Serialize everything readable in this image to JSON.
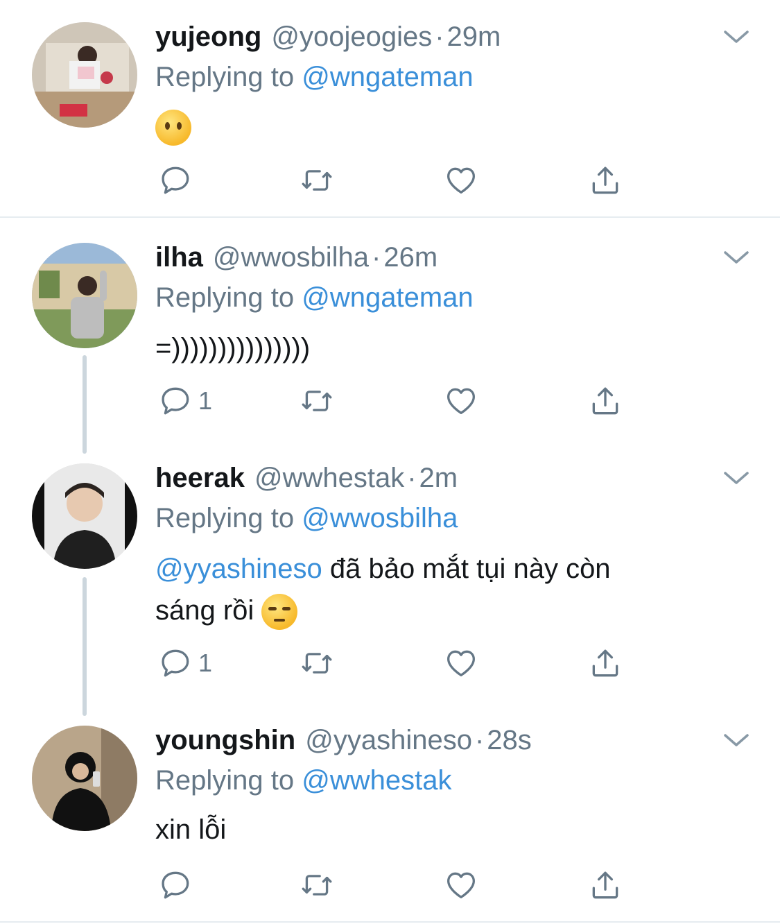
{
  "tweets": [
    {
      "name": "yujeong",
      "handle": "@yoojeogies",
      "time": "29m",
      "replying_prefix": "Replying to",
      "replying_to": "@wngateman",
      "body_emoji": "no-mouth-face",
      "reply_count": "",
      "avatar_colors": {
        "bg": "#cfc6b8",
        "accent": "#c5394a"
      }
    },
    {
      "name": "ilha",
      "handle": "@wwosbilha",
      "time": "26m",
      "replying_prefix": "Replying to",
      "replying_to": "@wngateman",
      "body": "=)))))))))))))))",
      "reply_count": "1",
      "avatar_colors": {
        "bg": "#9bb9d8",
        "accent": "#8e8e8e"
      }
    },
    {
      "name": "heerak",
      "handle": "@wwhestak",
      "time": "2m",
      "replying_prefix": "Replying to",
      "replying_to": "@wwosbilha",
      "body_mention": "@yyashineso",
      "body_line1": " đã bảo mắt tụi này còn",
      "body_line2": "sáng rồi ",
      "body_emoji": "unamused-face",
      "reply_count": "1",
      "avatar_colors": {
        "bg": "#e9e9e9",
        "accent": "#1f1f1f"
      }
    },
    {
      "name": "youngshin",
      "handle": "@yyashineso",
      "time": "28s",
      "replying_prefix": "Replying to",
      "replying_to": "@wwhestak",
      "body": "xin lỗi",
      "reply_count": "",
      "avatar_colors": {
        "bg": "#b9a58a",
        "accent": "#111111"
      }
    }
  ],
  "dot": "·",
  "colors": {
    "link": "#3a8fd9",
    "muted": "#657786",
    "text": "#14171a",
    "thread_line": "#ccd6dd"
  }
}
